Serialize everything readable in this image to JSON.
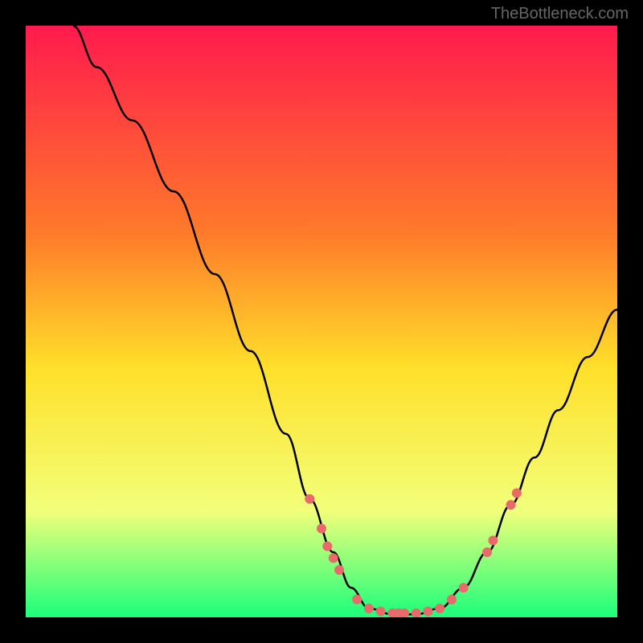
{
  "watermark": "TheBottleneck.com",
  "chart_data": {
    "type": "line",
    "title": "",
    "xlabel": "",
    "ylabel": "",
    "xlim": [
      0,
      100
    ],
    "ylim": [
      0,
      100
    ],
    "background_gradient": {
      "top": "#ff1a4d",
      "mid1": "#ff7a2a",
      "mid2": "#ffe02a",
      "mid3": "#f2ff7a",
      "bottom": "#1aff7a"
    },
    "curve": [
      {
        "x": 8,
        "y": 100
      },
      {
        "x": 12,
        "y": 93
      },
      {
        "x": 18,
        "y": 84
      },
      {
        "x": 25,
        "y": 72
      },
      {
        "x": 32,
        "y": 58
      },
      {
        "x": 38,
        "y": 45
      },
      {
        "x": 44,
        "y": 31
      },
      {
        "x": 48,
        "y": 20
      },
      {
        "x": 52,
        "y": 11
      },
      {
        "x": 55,
        "y": 5
      },
      {
        "x": 58,
        "y": 1.5
      },
      {
        "x": 62,
        "y": 0.5
      },
      {
        "x": 66,
        "y": 0.5
      },
      {
        "x": 70,
        "y": 1.5
      },
      {
        "x": 74,
        "y": 5
      },
      {
        "x": 78,
        "y": 11
      },
      {
        "x": 82,
        "y": 19
      },
      {
        "x": 86,
        "y": 27
      },
      {
        "x": 90,
        "y": 35
      },
      {
        "x": 95,
        "y": 44
      },
      {
        "x": 100,
        "y": 52
      }
    ],
    "markers": [
      {
        "x": 48,
        "y": 20
      },
      {
        "x": 50,
        "y": 15
      },
      {
        "x": 51,
        "y": 12
      },
      {
        "x": 52,
        "y": 10
      },
      {
        "x": 53,
        "y": 8
      },
      {
        "x": 56,
        "y": 3
      },
      {
        "x": 58,
        "y": 1.5
      },
      {
        "x": 60,
        "y": 1
      },
      {
        "x": 62,
        "y": 0.7
      },
      {
        "x": 63,
        "y": 0.7
      },
      {
        "x": 64,
        "y": 0.7
      },
      {
        "x": 66,
        "y": 0.7
      },
      {
        "x": 68,
        "y": 1
      },
      {
        "x": 70,
        "y": 1.5
      },
      {
        "x": 72,
        "y": 3
      },
      {
        "x": 74,
        "y": 5
      },
      {
        "x": 78,
        "y": 11
      },
      {
        "x": 79,
        "y": 13
      },
      {
        "x": 82,
        "y": 19
      },
      {
        "x": 83,
        "y": 21
      }
    ],
    "marker_color": "#e86a6a",
    "curve_color": "#000000"
  }
}
